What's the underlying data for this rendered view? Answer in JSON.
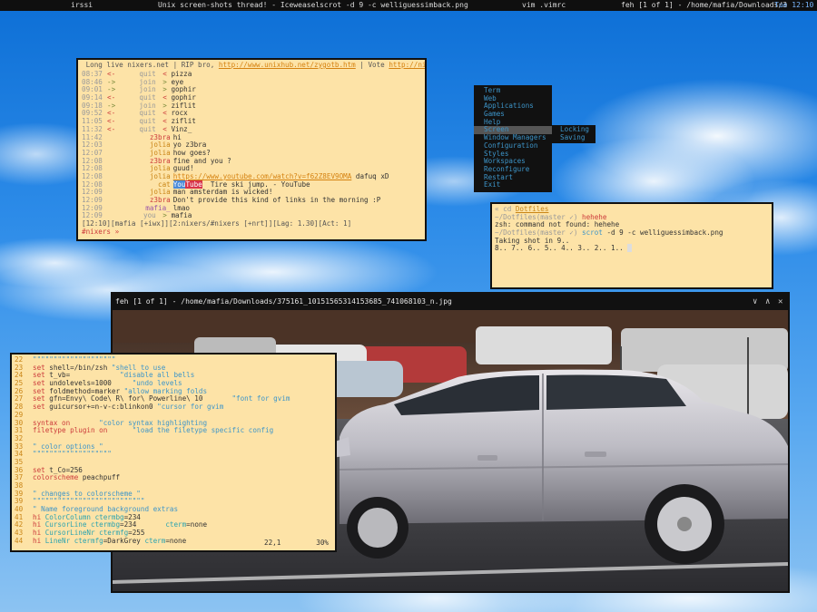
{
  "topbar": {
    "left": "irssi",
    "iceweasel": "Unix screen-shots thread! - Iceweasel",
    "scrot": "scrot -d 9 -c welliguessimback.png",
    "vim": "vim .vimrc",
    "feh": "feh [1 of 1] - /home/mafia/Downloads/3",
    "clock": "Tue 12:10"
  },
  "irssi": {
    "topic": " Long live nixers.net | RIP bro, ",
    "topic_link1": "http://www.unixhub.net/zygotb.htm",
    "topic_sep": " | Vote ",
    "topic_link2": "http://nixe",
    "lines": [
      {
        "ts": "08:37",
        "arrow": "<-",
        "nick": "quit",
        "nc": "gray",
        "sep": "<",
        "msg": "pizza",
        "kind": "event"
      },
      {
        "ts": "08:46",
        "arrow": "->",
        "nick": "join",
        "nc": "gray",
        "sep": ">",
        "msg": "eye",
        "kind": "event"
      },
      {
        "ts": "09:01",
        "arrow": "->",
        "nick": "join",
        "nc": "gray",
        "sep": ">",
        "msg": "gophir",
        "kind": "event"
      },
      {
        "ts": "09:14",
        "arrow": "<-",
        "nick": "quit",
        "nc": "gray",
        "sep": "<",
        "msg": "gophir",
        "kind": "event"
      },
      {
        "ts": "09:18",
        "arrow": "->",
        "nick": "join",
        "nc": "gray",
        "sep": ">",
        "msg": "ziflit",
        "kind": "event"
      },
      {
        "ts": "09:52",
        "arrow": "<-",
        "nick": "quit",
        "nc": "gray",
        "sep": "<",
        "msg": "rocx",
        "kind": "event"
      },
      {
        "ts": "11:05",
        "arrow": "<-",
        "nick": "quit",
        "nc": "gray",
        "sep": "<",
        "msg": "ziflit",
        "kind": "event"
      },
      {
        "ts": "11:32",
        "arrow": "<-",
        "nick": "quit",
        "nc": "gray",
        "sep": "<",
        "msg": "Vinz_",
        "kind": "event"
      },
      {
        "ts": "11:42",
        "arrow": "",
        "nick": "z3bra",
        "nc": "red",
        "sep": "",
        "msg": "hi",
        "kind": "msg"
      },
      {
        "ts": "12:03",
        "arrow": "",
        "nick": "jolia",
        "nc": "orange",
        "sep": "",
        "msg": "yo z3bra",
        "kind": "msg"
      },
      {
        "ts": "12:07",
        "arrow": "",
        "nick": "jolia",
        "nc": "orange",
        "sep": "",
        "msg": "how goes?",
        "kind": "msg"
      },
      {
        "ts": "12:08",
        "arrow": "",
        "nick": "z3bra",
        "nc": "red",
        "sep": "",
        "msg": "fine and you ?",
        "kind": "msg"
      },
      {
        "ts": "12:08",
        "arrow": "",
        "nick": "jolia",
        "nc": "orange",
        "sep": "",
        "msg": "guud!",
        "kind": "msg"
      },
      {
        "ts": "12:08",
        "arrow": "",
        "nick": "jolia",
        "nc": "orange",
        "sep": "",
        "msg": "https://www.youtube.com/watch?v=f62Z8EV9OMA",
        "msg2": " dafuq xD",
        "kind": "link"
      },
      {
        "ts": "12:08",
        "arrow": "",
        "nick": "cat",
        "nc": "orange",
        "sep": "",
        "msg": "YouTube",
        "msg2": "  Tire ski jump. - YouTube",
        "kind": "yt"
      },
      {
        "ts": "12:09",
        "arrow": "",
        "nick": "jolia",
        "nc": "orange",
        "sep": "",
        "msg": "man amsterdam is wicked!",
        "kind": "msg"
      },
      {
        "ts": "12:09",
        "arrow": "",
        "nick": "z3bra",
        "nc": "red",
        "sep": "",
        "msg": "Don't provide this kind of links in the morning :P",
        "kind": "msg"
      },
      {
        "ts": "12:09",
        "arrow": "",
        "nick": "mafia_",
        "nc": "purple",
        "sep": "",
        "msg": "lmao",
        "kind": "msg"
      },
      {
        "ts": "12:09",
        "arrow": "",
        "nick": "you",
        "nc": "gray",
        "sep": ">",
        "msg": "mafia",
        "kind": "event"
      }
    ],
    "status": "[12:10][mafia [+iwx]][2:nixers/#nixers [+nrt]][Lag: 1.30][Act: 1]",
    "prompt": "#nixers »"
  },
  "menu": {
    "items": [
      "Term",
      "Web",
      "Applications",
      "Games",
      "Help",
      "Screen",
      "Window Managers",
      "Configuration",
      "Styles",
      "Workspaces",
      "Reconfigure",
      "Restart",
      "Exit"
    ],
    "active": "Screen",
    "submenu": [
      "Locking",
      "Saving"
    ]
  },
  "zsh": {
    "l1_prompt": "« cd ",
    "l1_arg": "Dotfiles",
    "l2_prompt": "~/Dotfiles(master ✓) ",
    "l2_cmd": "hehehe",
    "l3": "zsh: command not found: hehehe",
    "l4_prompt": "~/Dotfiles(master ✓) ",
    "l4_cmd": "scrot",
    "l4_rest": " -d 9 -c welliguessimback.png",
    "l5": "Taking shot in 9..",
    "l6": "8.. 7.. 6.. 5.. 4.. 3.. 2.. 1.. "
  },
  "feh": {
    "title": "feh [1 of 1] - /home/mafia/Downloads/375161_10151565314153685_741068103_n.jpg",
    "controls": [
      "∨",
      "∧",
      "✕"
    ]
  },
  "vim": {
    "lines": [
      {
        "n": "22",
        "parts": [
          {
            "t": "\"\"\"\"\"\"\"\"\"\"\"\"\"\"\"\"\"\"\"\"",
            "c": "str"
          }
        ]
      },
      {
        "n": "23",
        "parts": [
          {
            "t": "set ",
            "c": "kw"
          },
          {
            "t": "shell=/bin/zsh ",
            "c": ""
          },
          {
            "t": "\"shell to use",
            "c": "str"
          }
        ]
      },
      {
        "n": "24",
        "parts": [
          {
            "t": "set ",
            "c": "kw"
          },
          {
            "t": "t_vb=            ",
            "c": ""
          },
          {
            "t": "\"disable all bells",
            "c": "str"
          }
        ]
      },
      {
        "n": "25",
        "parts": [
          {
            "t": "set ",
            "c": "kw"
          },
          {
            "t": "undolevels=1000     ",
            "c": ""
          },
          {
            "t": "\"undo levels",
            "c": "str"
          }
        ]
      },
      {
        "n": "26",
        "parts": [
          {
            "t": "set ",
            "c": "kw"
          },
          {
            "t": "foldmethod=marker ",
            "c": ""
          },
          {
            "t": "\"allow marking folds",
            "c": "str"
          }
        ]
      },
      {
        "n": "27",
        "parts": [
          {
            "t": "set ",
            "c": "kw"
          },
          {
            "t": "gfn=Envy\\ Code\\ R\\ for\\ Powerline\\ 10       ",
            "c": ""
          },
          {
            "t": "\"font for gvim",
            "c": "str"
          }
        ]
      },
      {
        "n": "28",
        "parts": [
          {
            "t": "set ",
            "c": "kw"
          },
          {
            "t": "guicursor+=n-v-c:blinkon0 ",
            "c": ""
          },
          {
            "t": "\"cursor for gvim",
            "c": "str"
          }
        ]
      },
      {
        "n": "29",
        "parts": []
      },
      {
        "n": "30",
        "parts": [
          {
            "t": "syntax on       ",
            "c": "kw"
          },
          {
            "t": "\"color syntax highlighting",
            "c": "str"
          }
        ]
      },
      {
        "n": "31",
        "parts": [
          {
            "t": "filetype plugin on      ",
            "c": "kw"
          },
          {
            "t": "\"load the filetype specific config",
            "c": "str"
          }
        ]
      },
      {
        "n": "32",
        "parts": []
      },
      {
        "n": "33",
        "parts": [
          {
            "t": "\" color options \"",
            "c": "str"
          }
        ]
      },
      {
        "n": "34",
        "parts": [
          {
            "t": "\"\"\"\"\"\"\"\"\"\"\"\"\"\"\"\"\"\"\"",
            "c": "str"
          }
        ]
      },
      {
        "n": "35",
        "parts": []
      },
      {
        "n": "36",
        "parts": [
          {
            "t": "set ",
            "c": "kw"
          },
          {
            "t": "t_Co=256",
            "c": ""
          }
        ]
      },
      {
        "n": "37",
        "parts": [
          {
            "t": "colorscheme ",
            "c": "kw"
          },
          {
            "t": "peachpuff",
            "c": ""
          }
        ]
      },
      {
        "n": "38",
        "parts": []
      },
      {
        "n": "39",
        "parts": [
          {
            "t": "\" changes to colorscheme \"",
            "c": "str"
          }
        ]
      },
      {
        "n": "39",
        "parts": [
          {
            "t": "\"\"\"\"\"\"\"\"\"\"\"\"\"\"\"\"\"\"\"\"\"\"\"\"\"\"\"",
            "c": "str"
          }
        ]
      },
      {
        "n": "40",
        "parts": [
          {
            "t": "\" Name foreground background extras",
            "c": "str"
          }
        ]
      },
      {
        "n": "41",
        "parts": [
          {
            "t": "hi ",
            "c": "kw"
          },
          {
            "t": "ColorColumn ctermbg",
            "c": "vt"
          },
          {
            "t": "=234",
            "c": ""
          }
        ]
      },
      {
        "n": "42",
        "parts": [
          {
            "t": "hi ",
            "c": "kw"
          },
          {
            "t": "CursorLine ctermbg",
            "c": "vt"
          },
          {
            "t": "=234       ",
            "c": ""
          },
          {
            "t": "cterm",
            "c": "vt"
          },
          {
            "t": "=none",
            "c": ""
          }
        ]
      },
      {
        "n": "43",
        "parts": [
          {
            "t": "hi ",
            "c": "kw"
          },
          {
            "t": "CursorLineNr ctermfg",
            "c": "vt"
          },
          {
            "t": "=255",
            "c": ""
          }
        ]
      },
      {
        "n": "44",
        "parts": [
          {
            "t": "hi ",
            "c": "kw"
          },
          {
            "t": "LineNr ctermfg",
            "c": "vt"
          },
          {
            "t": "=DarkGrey ",
            "c": ""
          },
          {
            "t": "cterm",
            "c": "vt"
          },
          {
            "t": "=none",
            "c": ""
          }
        ]
      }
    ],
    "ruler_pos": "22,1",
    "ruler_pct": "30%"
  }
}
